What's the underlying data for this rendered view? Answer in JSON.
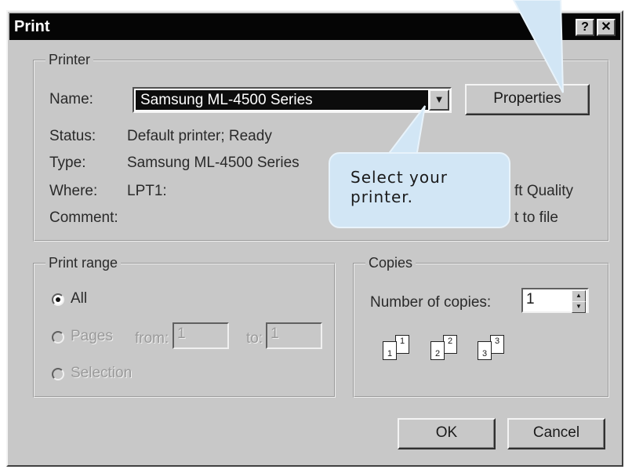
{
  "window": {
    "title": "Print",
    "help_button": "?",
    "close_button": "✕"
  },
  "printer_group": {
    "legend": "Printer",
    "name_label": "Name:",
    "name_value": "Samsung ML-4500 Series",
    "properties_button": "Properties",
    "status_label": "Status:",
    "status_value": "Default printer; Ready",
    "type_label": "Type:",
    "type_value": "Samsung ML-4500 Series",
    "where_label": "Where:",
    "where_value": "LPT1:",
    "comment_label": "Comment:",
    "draft_quality_partial": "ft Quality",
    "print_to_file_partial": "t to file"
  },
  "print_range": {
    "legend": "Print range",
    "all_label": "All",
    "pages_label": "Pages",
    "from_label": "from:",
    "from_value": "1",
    "to_label": "to:",
    "to_value": "1",
    "selection_label": "Selection",
    "selected": "all"
  },
  "copies": {
    "legend": "Copies",
    "number_label": "Number of copies:",
    "number_value": "1",
    "collate_pages": [
      {
        "back": "1",
        "front": "1"
      },
      {
        "back": "2",
        "front": "2"
      },
      {
        "back": "3",
        "front": "3"
      }
    ]
  },
  "buttons": {
    "ok": "OK",
    "cancel": "Cancel"
  },
  "callout": {
    "text": "Select your\nprinter."
  },
  "colors": {
    "dialog_bg": "#c8c8c8",
    "titlebar_bg": "#050505",
    "callout_bg": "#d2e6f5"
  }
}
